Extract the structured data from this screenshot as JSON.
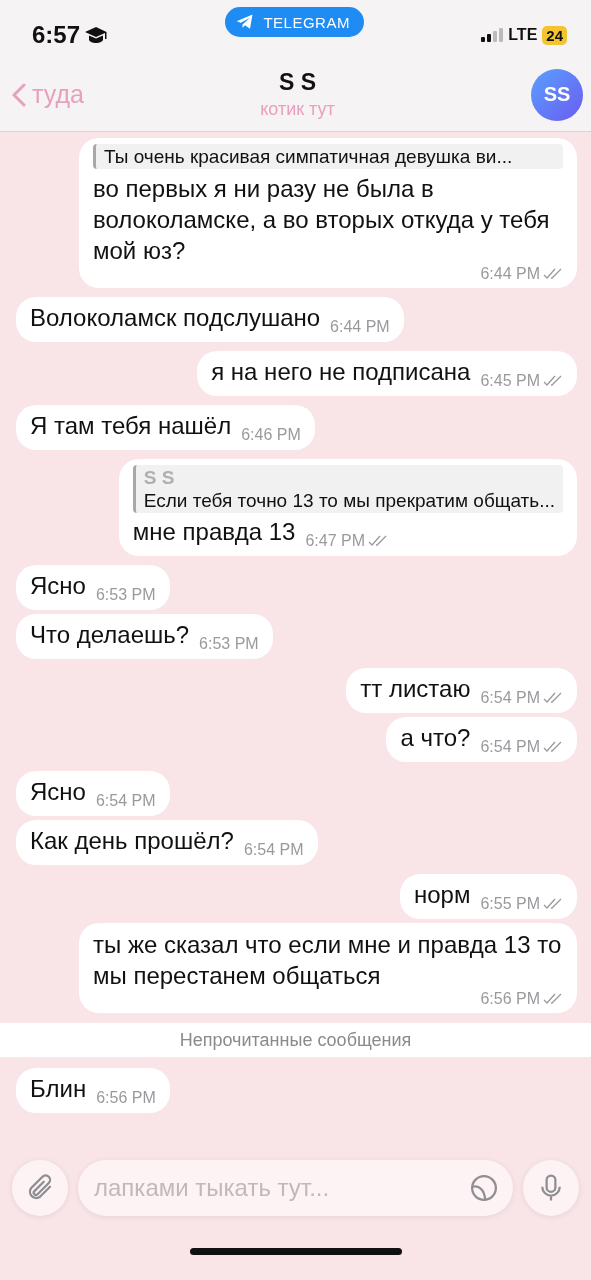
{
  "status_bar": {
    "time": "6:57",
    "app_pill": "TELEGRAM",
    "network": "LTE",
    "battery": "24"
  },
  "header": {
    "back": "туда",
    "title": "S S",
    "subtitle": "котик тут",
    "avatar": "SS"
  },
  "messages": [
    {
      "kind": "outgoing",
      "reply": {
        "text": "Ты очень красивая симпатичная девушка ви..."
      },
      "text": "во первых я ни разу не была в волоколамске, а во вторых откуда у тебя мой юз?",
      "time": "6:44 PM",
      "read": true
    },
    {
      "kind": "incoming",
      "text": "Волоколамск подслушано",
      "time": "6:44 PM"
    },
    {
      "kind": "outgoing",
      "text": "я на него не подписана",
      "time": "6:45 PM",
      "read": true
    },
    {
      "kind": "incoming",
      "text": "Я там тебя нашёл",
      "time": "6:46 PM"
    },
    {
      "kind": "outgoing",
      "reply": {
        "sender": "S S",
        "text": "Если тебя точно 13 то мы прекратим общать..."
      },
      "text": "мне правда 13",
      "time": "6:47 PM",
      "read": true
    },
    {
      "kind": "incoming",
      "text": "Ясно",
      "time": "6:53 PM"
    },
    {
      "kind": "incoming",
      "text": "Что делаешь?",
      "time": "6:53 PM"
    },
    {
      "kind": "outgoing",
      "text": "тт листаю",
      "time": "6:54 PM",
      "read": true
    },
    {
      "kind": "outgoing",
      "text": "а что?",
      "time": "6:54 PM",
      "read": true
    },
    {
      "kind": "incoming",
      "text": "Ясно",
      "time": "6:54 PM"
    },
    {
      "kind": "incoming",
      "text": "Как день прошёл?",
      "time": "6:54 PM"
    },
    {
      "kind": "outgoing",
      "text": "норм",
      "time": "6:55 PM",
      "read": true
    },
    {
      "kind": "outgoing",
      "text": "ты же сказал что если мне и правда 13 то мы перестанем общаться",
      "time": "6:56 PM",
      "read": true
    },
    {
      "kind": "divider",
      "text": "Непрочитанные сообщения"
    },
    {
      "kind": "incoming",
      "text": "Блин",
      "time": "6:56 PM"
    }
  ],
  "composer": {
    "placeholder": "лапками тыкать тут..."
  }
}
